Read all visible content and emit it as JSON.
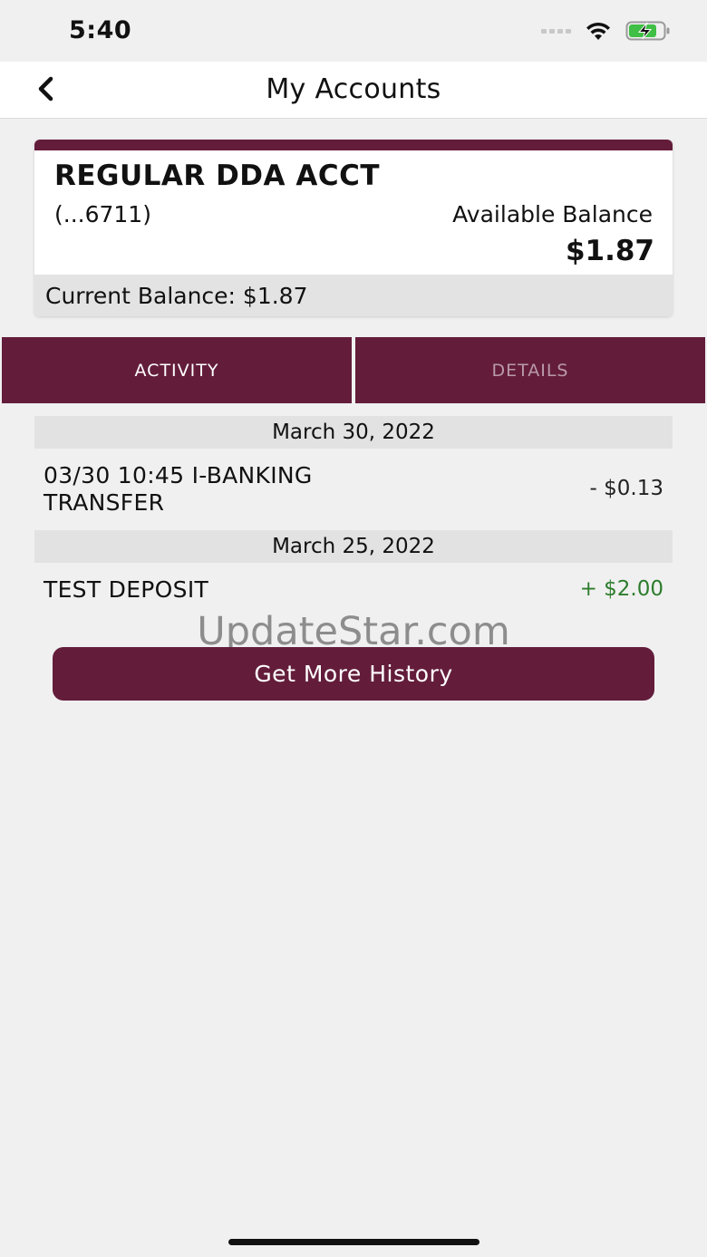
{
  "status_bar": {
    "time": "5:40",
    "icons": [
      "signal-icon",
      "wifi-icon",
      "battery-charging-icon"
    ]
  },
  "nav": {
    "title": "My Accounts",
    "back_icon": "chevron-left-icon"
  },
  "account": {
    "name": "REGULAR DDA ACCT",
    "number": "(...6711)",
    "available_label": "Available Balance",
    "available_amount": "$1.87",
    "current_balance": "Current Balance: $1.87"
  },
  "tabs": [
    {
      "label": "ACTIVITY",
      "selected": true
    },
    {
      "label": "DETAILS",
      "selected": false
    }
  ],
  "activity": [
    {
      "date": "March 30, 2022",
      "transactions": [
        {
          "line1": "03/30 10:45 I-BANKING",
          "line2": "TRANSFER",
          "amount": "- $0.13",
          "type": "debit"
        }
      ]
    },
    {
      "date": "March 25, 2022",
      "transactions": [
        {
          "line1": "TEST DEPOSIT",
          "line2": "",
          "amount": "+ $2.00",
          "type": "credit"
        }
      ]
    }
  ],
  "watermark": "UpdateStar.com",
  "history_button_label": "Get More History",
  "colors": {
    "brand": "#631d3b",
    "credit": "#2d7d2d",
    "background": "#f0f0f0"
  }
}
